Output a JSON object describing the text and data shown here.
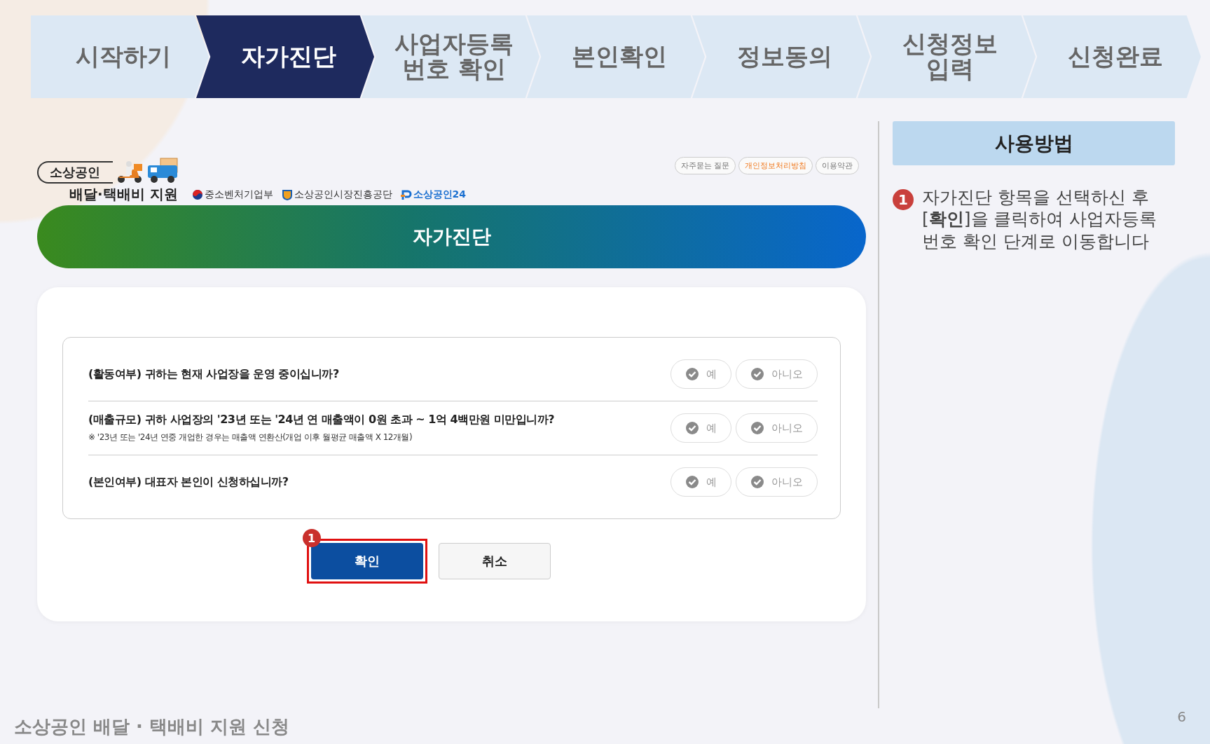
{
  "steps": [
    {
      "label": "시작하기",
      "selected": false
    },
    {
      "label": "자가진단",
      "selected": true
    },
    {
      "label": "사업자등록\n번호 확인",
      "selected": false
    },
    {
      "label": "본인확인",
      "selected": false
    },
    {
      "label": "정보동의",
      "selected": false
    },
    {
      "label": "신청정보\n입력",
      "selected": false
    },
    {
      "label": "신청완료",
      "selected": false
    }
  ],
  "header": {
    "logo_title": "소상공인",
    "logo_subtitle": "배달·택배비 지원",
    "partners": [
      {
        "name": "중소벤처기업부",
        "kind": "ministry"
      },
      {
        "name": "소상공인시장진흥공단",
        "kind": "agency"
      },
      {
        "name": "소상공인24",
        "kind": "portal"
      }
    ],
    "links": [
      {
        "label": "자주묻는 질문",
        "kind": "plain"
      },
      {
        "label": "개인정보처리방침",
        "kind": "highlight"
      },
      {
        "label": "이용약관",
        "kind": "plain"
      }
    ]
  },
  "banner": {
    "title": "자가진단"
  },
  "questions": [
    {
      "text": "(활동여부) 귀하는 현재 사업장을 운영 중이십니까?",
      "options": [
        {
          "label": "예",
          "selected": false
        },
        {
          "label": "아니오",
          "selected": false
        }
      ]
    },
    {
      "text": "(매출규모) 귀하 사업장의 '23년 또는 '24년 연 매출액이 0원 초과 ~ 1억 4백만원 미만입니까?",
      "note": "※ '23년 또는 '24년 연중 개업한 경우는 매출액 연환산(개업 이후 월평균 매출액 X 12개월)",
      "options": [
        {
          "label": "예",
          "selected": false
        },
        {
          "label": "아니오",
          "selected": false
        }
      ]
    },
    {
      "text": "(본인여부) 대표자 본인이 신청하십니까?",
      "options": [
        {
          "label": "예",
          "selected": false
        },
        {
          "label": "아니오",
          "selected": false
        }
      ]
    }
  ],
  "buttons": [
    {
      "label": "확인",
      "kind": "primary",
      "badge": "1",
      "highlighted": true
    },
    {
      "label": "취소",
      "kind": "secondary"
    }
  ],
  "help": {
    "title": "사용방법",
    "items": [
      {
        "number": "1",
        "text": "자가진단 항목을 선택하신 후 [**확인**]을 클릭하여 사업자등록 번호 확인 단계로 이동합니다"
      }
    ]
  },
  "footer": {
    "title": "소상공인 배달 · 택배비 지원 신청",
    "page": "6"
  }
}
